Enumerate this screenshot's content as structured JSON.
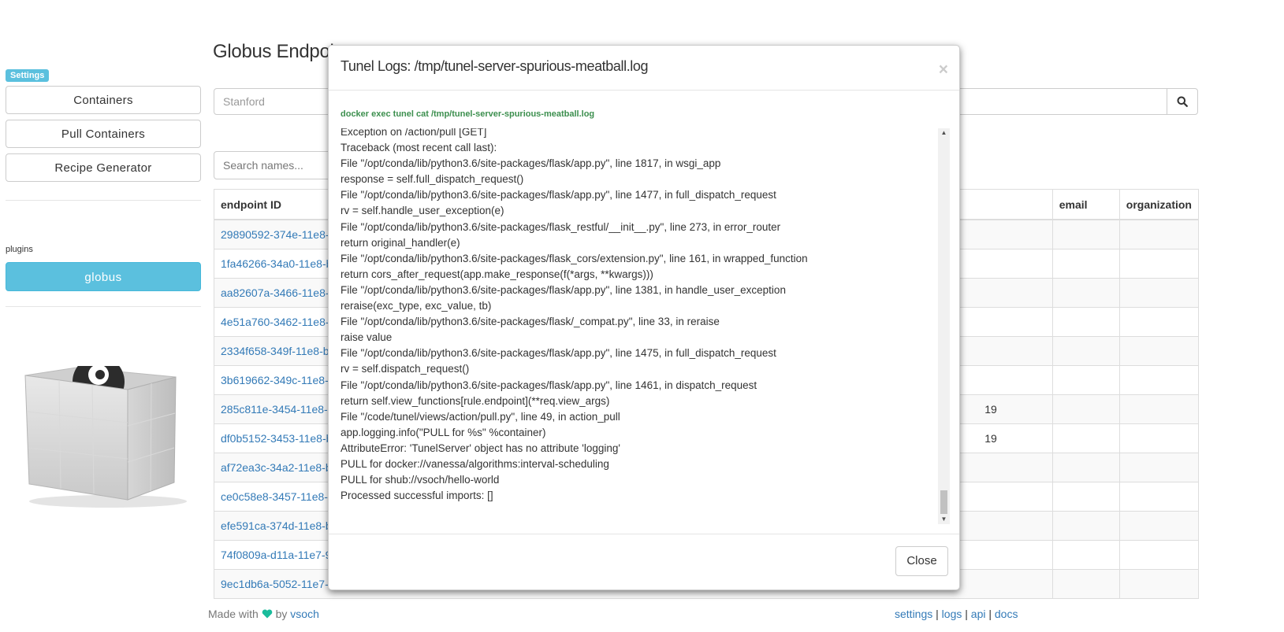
{
  "sidebar": {
    "badge": "Settings",
    "buttons": [
      "Containers",
      "Pull Containers",
      "Recipe Generator"
    ],
    "plugins_label": "plugins",
    "plugin_button": "globus"
  },
  "main": {
    "title": "Globus Endpoi",
    "search_value": "Stanford",
    "search_names_placeholder": "Search names...",
    "table": {
      "headers": [
        "endpoint ID",
        "email",
        "organization"
      ],
      "rows": [
        {
          "id": "29890592-374e-11e8-",
          "extra": ""
        },
        {
          "id": "1fa46266-34a0-11e8-b",
          "extra": ""
        },
        {
          "id": "aa82607a-3466-11e8-",
          "extra": ""
        },
        {
          "id": "4e51a760-3462-11e8-",
          "extra": ""
        },
        {
          "id": "2334f658-349f-11e8-b",
          "extra": ""
        },
        {
          "id": "3b619662-349c-11e8-",
          "extra": ""
        },
        {
          "id": "285c811e-3454-11e8-",
          "extra": "19"
        },
        {
          "id": "df0b5152-3453-11e8-b",
          "extra": "19"
        },
        {
          "id": "af72ea3c-34a2-11e8-b",
          "extra": ""
        },
        {
          "id": "ce0c58e8-3457-11e8-",
          "extra": ""
        },
        {
          "id": "efe591ca-374d-11e8-b",
          "extra": ""
        },
        {
          "id": "74f0809a-d11a-11e7-9",
          "extra": ""
        },
        {
          "id": "9ec1db6a-5052-11e7-",
          "extra": ""
        }
      ]
    }
  },
  "modal": {
    "title": "Tunel Logs: /tmp/tunel-server-spurious-meatball.log",
    "close_x": "×",
    "command": "docker exec tunel cat /tmp/tunel-server-spurious-meatball.log",
    "log_lines": [
      "Exception on /action/pull [GET]",
      "Traceback (most recent call last):",
      "File \"/opt/conda/lib/python3.6/site-packages/flask/app.py\", line 1817, in wsgi_app",
      "response = self.full_dispatch_request()",
      "File \"/opt/conda/lib/python3.6/site-packages/flask/app.py\", line 1477, in full_dispatch_request",
      "rv = self.handle_user_exception(e)",
      "File \"/opt/conda/lib/python3.6/site-packages/flask_restful/__init__.py\", line 273, in error_router",
      "return original_handler(e)",
      "File \"/opt/conda/lib/python3.6/site-packages/flask_cors/extension.py\", line 161, in wrapped_function",
      "return cors_after_request(app.make_response(f(*args, **kwargs)))",
      "File \"/opt/conda/lib/python3.6/site-packages/flask/app.py\", line 1381, in handle_user_exception",
      "reraise(exc_type, exc_value, tb)",
      "File \"/opt/conda/lib/python3.6/site-packages/flask/_compat.py\", line 33, in reraise",
      "raise value",
      "File \"/opt/conda/lib/python3.6/site-packages/flask/app.py\", line 1475, in full_dispatch_request",
      "rv = self.dispatch_request()",
      "File \"/opt/conda/lib/python3.6/site-packages/flask/app.py\", line 1461, in dispatch_request",
      "return self.view_functions[rule.endpoint](**req.view_args)",
      "File \"/code/tunel/views/action/pull.py\", line 49, in action_pull",
      "app.logging.info(\"PULL for %s\" %container)",
      "AttributeError: 'TunelServer' object has no attribute 'logging'",
      "PULL for docker://vanessa/algorithms:interval-scheduling",
      "PULL for shub://vsoch/hello-world",
      "Processed successful imports: []"
    ],
    "close_button": "Close"
  },
  "footer": {
    "made_with": "Made with",
    "by": "by",
    "author": "vsoch",
    "links": [
      "settings",
      "logs",
      "api",
      "docs"
    ],
    "separator": "|"
  },
  "colors": {
    "info": "#5bc0de",
    "link": "#337ab7",
    "command": "#3c8f4e",
    "heart": "#1abc9c"
  }
}
